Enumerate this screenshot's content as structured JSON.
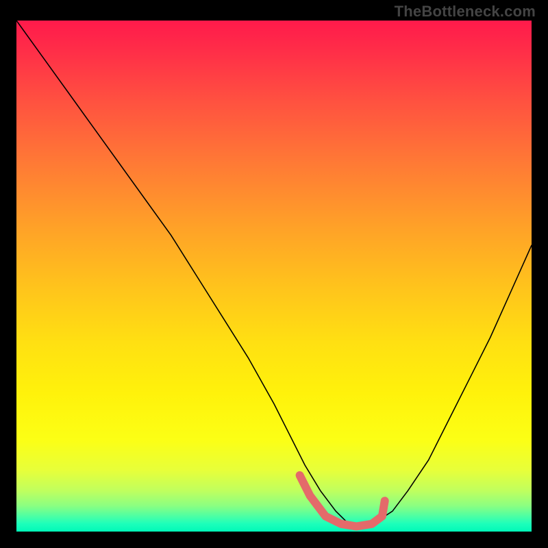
{
  "watermark": "TheBottleneck.com",
  "chart_data": {
    "type": "line",
    "title": "",
    "xlabel": "",
    "ylabel": "",
    "xlim": [
      0,
      100
    ],
    "ylim": [
      0,
      100
    ],
    "legend": null,
    "grid": false,
    "background_gradient": {
      "direction": "vertical",
      "stops": [
        {
          "pos": 0.0,
          "color": "#ff1a4b"
        },
        {
          "pos": 0.5,
          "color": "#ffc31c"
        },
        {
          "pos": 0.82,
          "color": "#fcff15"
        },
        {
          "pos": 1.0,
          "color": "#00f9b8"
        }
      ]
    },
    "series": [
      {
        "name": "bottleneck-curve",
        "stroke": "#000000",
        "x": [
          0,
          5,
          10,
          15,
          20,
          25,
          30,
          35,
          40,
          45,
          50,
          53,
          56,
          59,
          62,
          64,
          66,
          68,
          70,
          73,
          76,
          80,
          84,
          88,
          92,
          96,
          100
        ],
        "values": [
          100,
          93,
          86,
          79,
          72,
          65,
          58,
          50,
          42,
          34,
          25,
          19,
          13,
          8,
          4,
          2,
          1,
          1,
          2,
          4,
          8,
          14,
          22,
          30,
          38,
          47,
          56
        ]
      }
    ],
    "highlight": {
      "name": "optimal-range",
      "stroke": "#e46a6a",
      "points": [
        {
          "x": 55,
          "y": 11
        },
        {
          "x": 57,
          "y": 7
        },
        {
          "x": 60,
          "y": 3
        },
        {
          "x": 63,
          "y": 1.5
        },
        {
          "x": 66,
          "y": 1
        },
        {
          "x": 69,
          "y": 1.5
        },
        {
          "x": 71,
          "y": 3
        },
        {
          "x": 71.5,
          "y": 6
        }
      ]
    }
  }
}
